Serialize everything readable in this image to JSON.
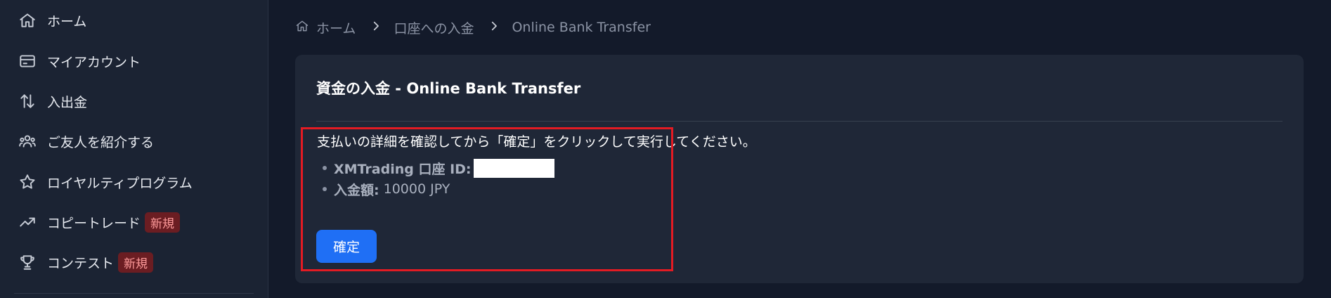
{
  "sidebar": {
    "items": [
      {
        "label": "ホーム",
        "icon": "home-icon"
      },
      {
        "label": "マイアカウント",
        "icon": "card-icon"
      },
      {
        "label": "入出金",
        "icon": "transfer-arrows-icon"
      },
      {
        "label": "ご友人を紹介する",
        "icon": "users-icon"
      },
      {
        "label": "ロイヤルティプログラム",
        "icon": "star-icon"
      },
      {
        "label": "コピートレード",
        "icon": "trend-up-icon",
        "badge": "新規"
      },
      {
        "label": "コンテスト",
        "icon": "trophy-icon",
        "badge": "新規"
      }
    ]
  },
  "breadcrumb": {
    "items": [
      "ホーム",
      "口座への入金",
      "Online Bank Transfer"
    ]
  },
  "card": {
    "title": "資金の入金 - Online Bank Transfer",
    "instructions": "支払いの詳細を確認してから「確定」をクリックして実行してください。",
    "details": [
      {
        "label": "XMTrading 口座 ID:",
        "value": ""
      },
      {
        "label": "入金額:",
        "value": "10000 JPY"
      }
    ],
    "confirm_label": "確定"
  },
  "colors": {
    "background": "#131a2a",
    "sidebar": "#1b2333",
    "card": "#1f2737",
    "primary_button": "#1f6ff5",
    "badge_bg": "#6b1d22",
    "badge_text": "#ff9b9b",
    "highlight_border": "#e31b23"
  }
}
